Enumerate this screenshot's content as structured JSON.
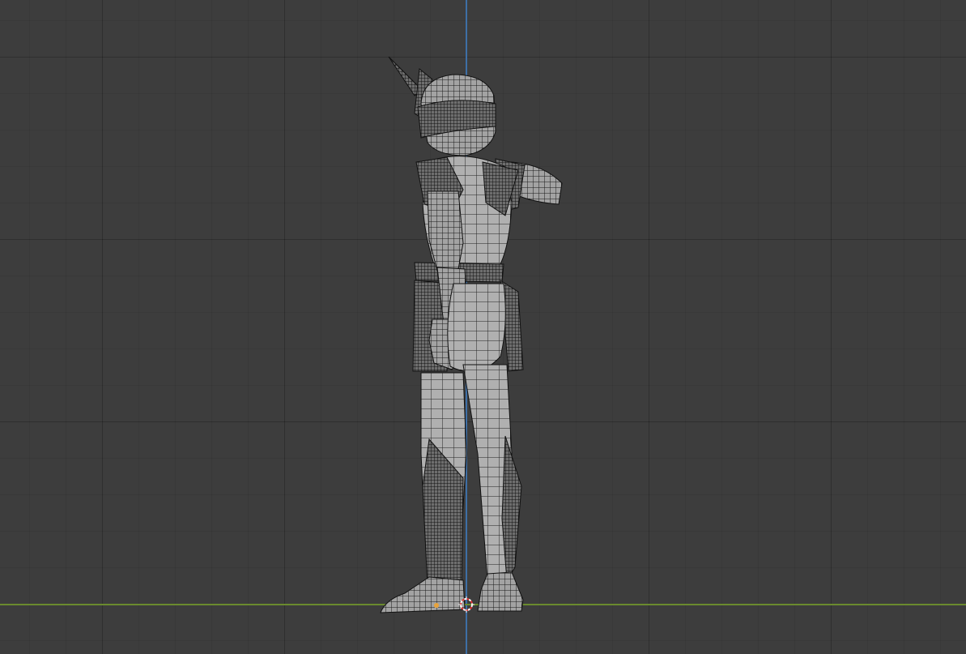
{
  "viewport": {
    "background_color": "#3d3d3d",
    "grid_color": "#2f2f2f",
    "axis_z_color": "#3e6fa6",
    "axis_y_color": "#6a8a2e",
    "wire_color": "#111111",
    "mesh_fill_color": "#9c9c9c"
  },
  "icons": {
    "cursor": "3d-cursor-icon",
    "origin": "object-origin-icon"
  }
}
